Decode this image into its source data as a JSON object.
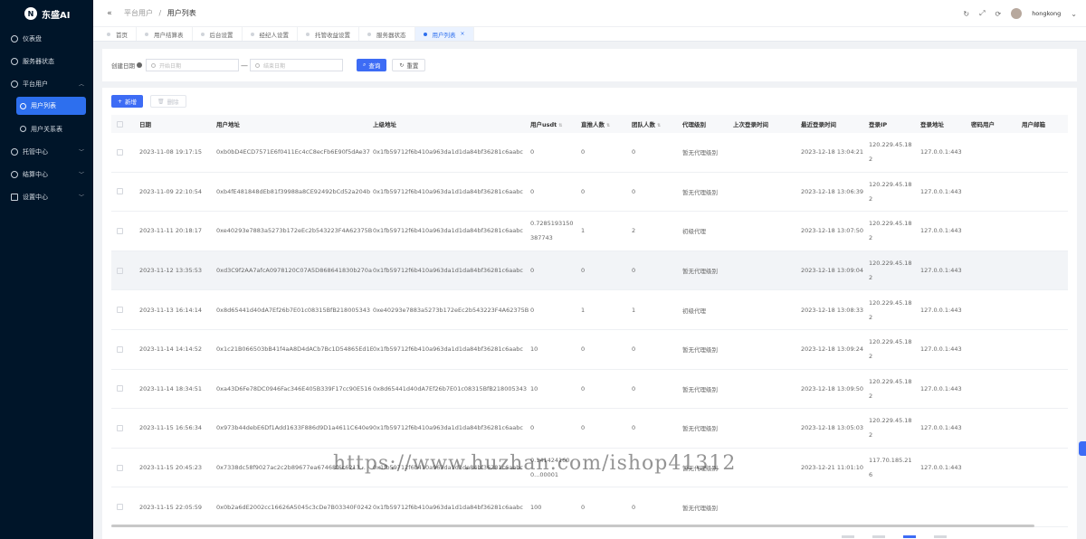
{
  "app": {
    "logo_mark": "N",
    "name": "东盛AI"
  },
  "sidebar": {
    "items": [
      {
        "label": "仪表盘",
        "icon": "dashboard-icon"
      },
      {
        "label": "服务器状态",
        "icon": "cloud-icon"
      },
      {
        "label": "平台用户",
        "icon": "target-icon",
        "expanded": true,
        "children": [
          {
            "label": "用户列表",
            "icon": "target-icon",
            "active": true
          },
          {
            "label": "用户关系表",
            "icon": "target-icon"
          }
        ]
      },
      {
        "label": "托管中心",
        "icon": "swap-icon"
      },
      {
        "label": "结算中心",
        "icon": "target-icon"
      },
      {
        "label": "设置中心",
        "icon": "edit-icon"
      }
    ]
  },
  "header": {
    "collapse_icon": "«",
    "breadcrumb": [
      "平台用户",
      "用户列表"
    ],
    "icons": [
      "↻",
      "⤢",
      "⟳"
    ],
    "username": "hongkong",
    "user_caret": "⌄"
  },
  "tabs": [
    {
      "label": "首页"
    },
    {
      "label": "用户结算表"
    },
    {
      "label": "后台设置"
    },
    {
      "label": "经纪人设置"
    },
    {
      "label": "托管收益设置"
    },
    {
      "label": "服务器状态"
    },
    {
      "label": "用户列表",
      "active": true,
      "close": "×"
    }
  ],
  "search": {
    "label": "创建日期",
    "start_placeholder": "开始日期",
    "sep": "—",
    "end_placeholder": "结束日期",
    "query_label": "查询",
    "query_icon": "⌕",
    "reset_label": "重置",
    "reset_icon": "↻"
  },
  "toolbar": {
    "add_label": "新增",
    "add_icon": "+",
    "delete_label": "删除",
    "delete_icon": "🗑"
  },
  "table": {
    "columns": [
      "日期",
      "用户地址",
      "上级地址",
      "用户usdt",
      "直推人数",
      "团队人数",
      "代理级别",
      "上次登录时间",
      "最近登录时间",
      "登录IP",
      "登录地址",
      "密码用户",
      "用户邮箱"
    ],
    "sort_icon": "⇅",
    "rows": [
      [
        "2023-11-08 19:17:15",
        "0xb0bD4ECD7571E6f0411Ec4cC8ecFb6E90f5dAe37",
        "0x1fb59712f6b410a963da1d1da84bf36281c6aabc",
        "0",
        "0",
        "0",
        "暂无代理级别",
        "",
        "2023-12-18 13:04:21",
        "120.229.45.182",
        "127.0.0.1:443",
        "",
        ""
      ],
      [
        "2023-11-09 22:10:54",
        "0xb4fE481848dEb81f39988a8CE92492bCd52a204b",
        "0x1fb59712f6b410a963da1d1da84bf36281c6aabc",
        "0",
        "0",
        "0",
        "暂无代理级别",
        "",
        "2023-12-18 13:06:39",
        "120.229.45.182",
        "127.0.0.1:443",
        "",
        ""
      ],
      [
        "2023-11-11 20:18:17",
        "0xe40293e7883a5273b172eEc2b543223F4A62375B",
        "0x1fb59712f6b410a963da1d1da84bf36281c6aabc",
        "0.7285193150387743",
        "1",
        "2",
        "初级代理",
        "",
        "2023-12-18 13:07:50",
        "120.229.45.182",
        "127.0.0.1:443",
        "",
        ""
      ],
      [
        "2023-11-12 13:35:53",
        "0xd3C9f2AA7afcA0978120C07A5D868641830b270a",
        "0x1fb59712f6b410a963da1d1da84bf36281c6aabc",
        "0",
        "0",
        "0",
        "暂无代理级别",
        "",
        "2023-12-18 13:09:04",
        "120.229.45.182",
        "127.0.0.1:443",
        "",
        ""
      ],
      [
        "2023-11-13 16:14:14",
        "0x8d65441d40dA7Ef26b7E01c08315BfB218005343",
        "0xe40293e7883a5273b172eEc2b543223F4A62375B",
        "0",
        "1",
        "1",
        "初级代理",
        "",
        "2023-12-18 13:08:33",
        "120.229.45.182",
        "127.0.0.1:443",
        "",
        ""
      ],
      [
        "2023-11-14 14:14:52",
        "0x1c21B066503bB41f4aA8D4dACb7Bc1D54865Ed1E",
        "0x1fb59712f6b410a963da1d1da84bf36281c6aabc",
        "10",
        "0",
        "0",
        "暂无代理级别",
        "",
        "2023-12-18 13:09:24",
        "120.229.45.182",
        "127.0.0.1:443",
        "",
        ""
      ],
      [
        "2023-11-14 18:34:51",
        "0xa43D6Fe78DC0946Fac346E405B339F17cc90E516",
        "0x8d65441d40dA7Ef26b7E01c08315BfB218005343",
        "10",
        "0",
        "0",
        "暂无代理级别",
        "",
        "2023-12-18 13:09:50",
        "120.229.45.182",
        "127.0.0.1:443",
        "",
        ""
      ],
      [
        "2023-11-15 16:56:34",
        "0x973b44debE6Df1Add1633F886d9D1a4611C640e9",
        "0x1fb59712f6b410a963da1d1da84bf36281c6aabc",
        "0",
        "0",
        "0",
        "暂无代理级别",
        "",
        "2023-12-18 13:05:03",
        "120.229.45.182",
        "127.0.0.1:443",
        "",
        ""
      ],
      [
        "2023-11-15 20:45:23",
        "0x7338dc58f9027ac2c2b89677ea67468f6c6213...",
        "0x1fb59712f6b410a963da1d1da84bf36281c6aabc",
        "0.1414241600...00001",
        "",
        "",
        "暂无代理级别",
        "",
        "2023-12-21 11:01:10",
        "117.70.185.216",
        "127.0.0.1:443",
        "",
        ""
      ],
      [
        "2023-11-15 22:05:59",
        "0x0b2a6dE2002cc16626A5045c3cDe7B03340F0242",
        "0x1fb59712f6b410a963da1d1da84bf36281c6aabc",
        "100",
        "0",
        "0",
        "暂无代理级别",
        "",
        "",
        "",
        "",
        "",
        ""
      ]
    ]
  },
  "watermark": "https://www.huzhan.com/ishop41312"
}
